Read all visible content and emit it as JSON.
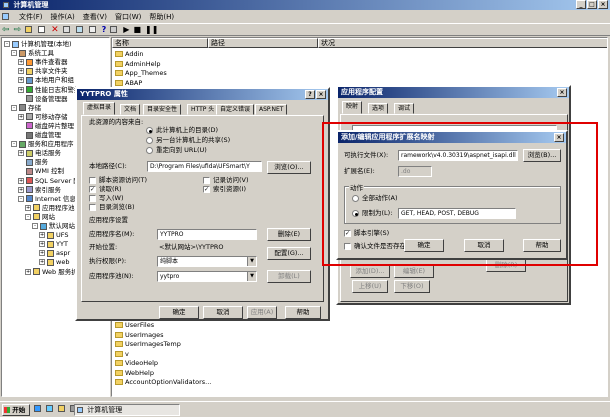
{
  "app": {
    "title": "计算机管理",
    "menu": [
      "文件(F)",
      "操作(A)",
      "查看(V)",
      "窗口(W)",
      "帮助(H)"
    ]
  },
  "tree": {
    "items": [
      {
        "label": "计算机管理(本地)",
        "depth": 0,
        "exp": "-",
        "icon": "computer-icon"
      },
      {
        "label": "系统工具",
        "depth": 1,
        "exp": "-",
        "icon": "tools-icon"
      },
      {
        "label": "事件查看器",
        "depth": 2,
        "exp": "+",
        "icon": "event-viewer-icon"
      },
      {
        "label": "共享文件夹",
        "depth": 2,
        "exp": "+",
        "icon": "share-folder-icon"
      },
      {
        "label": "本地用户和组",
        "depth": 2,
        "exp": "+",
        "icon": "users-icon"
      },
      {
        "label": "性能日志和警报",
        "depth": 2,
        "exp": "+",
        "icon": "performance-icon"
      },
      {
        "label": "设备管理器",
        "depth": 2,
        "exp": "",
        "icon": "device-manager-icon"
      },
      {
        "label": "存储",
        "depth": 1,
        "exp": "-",
        "icon": "storage-icon"
      },
      {
        "label": "可移动存储",
        "depth": 2,
        "exp": "+",
        "icon": "removable-storage-icon"
      },
      {
        "label": "磁盘碎片整理",
        "depth": 2,
        "exp": "",
        "icon": "defrag-icon"
      },
      {
        "label": "磁盘管理",
        "depth": 2,
        "exp": "",
        "icon": "disk-icon"
      },
      {
        "label": "服务和应用程序",
        "depth": 1,
        "exp": "-",
        "icon": "services-apps-icon"
      },
      {
        "label": "电话服务",
        "depth": 2,
        "exp": "+",
        "icon": "telephony-icon"
      },
      {
        "label": "服务",
        "depth": 2,
        "exp": "",
        "icon": "services-icon"
      },
      {
        "label": "WMI 控制",
        "depth": 2,
        "exp": "",
        "icon": "wmi-icon"
      },
      {
        "label": "SQL Server 配",
        "depth": 2,
        "exp": "+",
        "icon": "sql-icon"
      },
      {
        "label": "索引服务",
        "depth": 2,
        "exp": "+",
        "icon": "index-icon"
      },
      {
        "label": "Internet 信息",
        "depth": 2,
        "exp": "-",
        "icon": "iis-icon"
      },
      {
        "label": "应用程序池",
        "depth": 3,
        "exp": "+",
        "icon": "folder-icon"
      },
      {
        "label": "网站",
        "depth": 3,
        "exp": "-",
        "icon": "folder-icon"
      },
      {
        "label": "默认网站",
        "depth": 4,
        "exp": "-",
        "icon": "website-icon"
      },
      {
        "label": "UFS",
        "depth": 5,
        "exp": "+",
        "icon": "folder-icon"
      },
      {
        "label": "YYT",
        "depth": 5,
        "exp": "+",
        "icon": "folder-icon"
      },
      {
        "label": "aspr",
        "depth": 5,
        "exp": "+",
        "icon": "folder-icon"
      },
      {
        "label": "web",
        "depth": 5,
        "exp": "+",
        "icon": "folder-icon"
      },
      {
        "label": "Web 服务扩",
        "depth": 3,
        "exp": "+",
        "icon": "folder-icon"
      }
    ]
  },
  "list": {
    "columns": [
      "名称",
      "路径",
      "状况"
    ],
    "top_items": [
      "Addin",
      "AdminHelp",
      "App_Themes",
      "ABAP"
    ],
    "bottom_items": [
      "UserFiles",
      "UserImages",
      "UserImagesTemp",
      "v",
      "VideoHelp",
      "WebHelp",
      "AccountOptionValidators..."
    ]
  },
  "props": {
    "title": "YYTPRO 属性",
    "tabs": [
      "虚拟目录",
      "文档",
      "目录安全性",
      "HTTP 头",
      "自定义错误",
      "ASP.NET"
    ],
    "source_label": "此资源的内容来自:",
    "radio1": "此计算机上的目录(D)",
    "radio2": "另一台计算机上的共享(S)",
    "radio3": "重定向到 URL(U)",
    "local_path_label": "本地路径(C):",
    "local_path_value": "D:\\Program Files\\ufida\\UFSmart\\Y",
    "browse": "浏览(O)...",
    "script_source": "脚本资源访问(T)",
    "read": "读取(R)",
    "write": "写入(W)",
    "dir_browse": "目录浏览(B)",
    "log_visits": "记录访问(V)",
    "index_resource": "索引资源(I)",
    "app_settings": "应用程序设置",
    "app_name_label": "应用程序名(M):",
    "app_name_value": "YYTPRO",
    "remove": "删除(E)",
    "start_point_label": "开始位置:",
    "start_point_value": "<默认网站>\\YYTPRO",
    "config": "配置(G)...",
    "exec_perm_label": "执行权限(P):",
    "exec_perm_value": "纯脚本",
    "app_pool_label": "应用程序池(N):",
    "app_pool_value": "yytpro",
    "unload": "卸载(L)",
    "ok": "确定",
    "cancel": "取消",
    "apply": "应用(A)",
    "help": "帮助"
  },
  "appconfig": {
    "title": "应用程序配置",
    "tabs": [
      "映射",
      "选项",
      "调试"
    ],
    "add": "添加(D)...",
    "edit": "编辑(E)",
    "remove": "删除(R)",
    "move_up": "上移(U)",
    "move_down": "下移(O)"
  },
  "mapping": {
    "title": "添加/编辑应用程序扩展名映射",
    "exe_label": "可执行文件(X):",
    "exe_value": "ramework\\v4.0.30319\\aspnet_isapi.dll",
    "browse": "浏览(B)...",
    "ext_label": "扩展名(E):",
    "ext_value": ".do",
    "verbs_group": "动作",
    "all_verbs": "全部动作(A)",
    "limit_to": "限制为(L):",
    "limit_value": "GET, HEAD, POST, DEBUG",
    "script_engine": "脚本引擎(S)",
    "verify_file": "确认文件是否存在(V)",
    "ok": "确定",
    "cancel": "取消",
    "help": "帮助"
  },
  "taskbar": {
    "start": "开始",
    "task": "计算机管理"
  },
  "colors": {
    "highlight_border": "#e00000",
    "title_start": "#0a246a",
    "title_end": "#a6caf0"
  }
}
